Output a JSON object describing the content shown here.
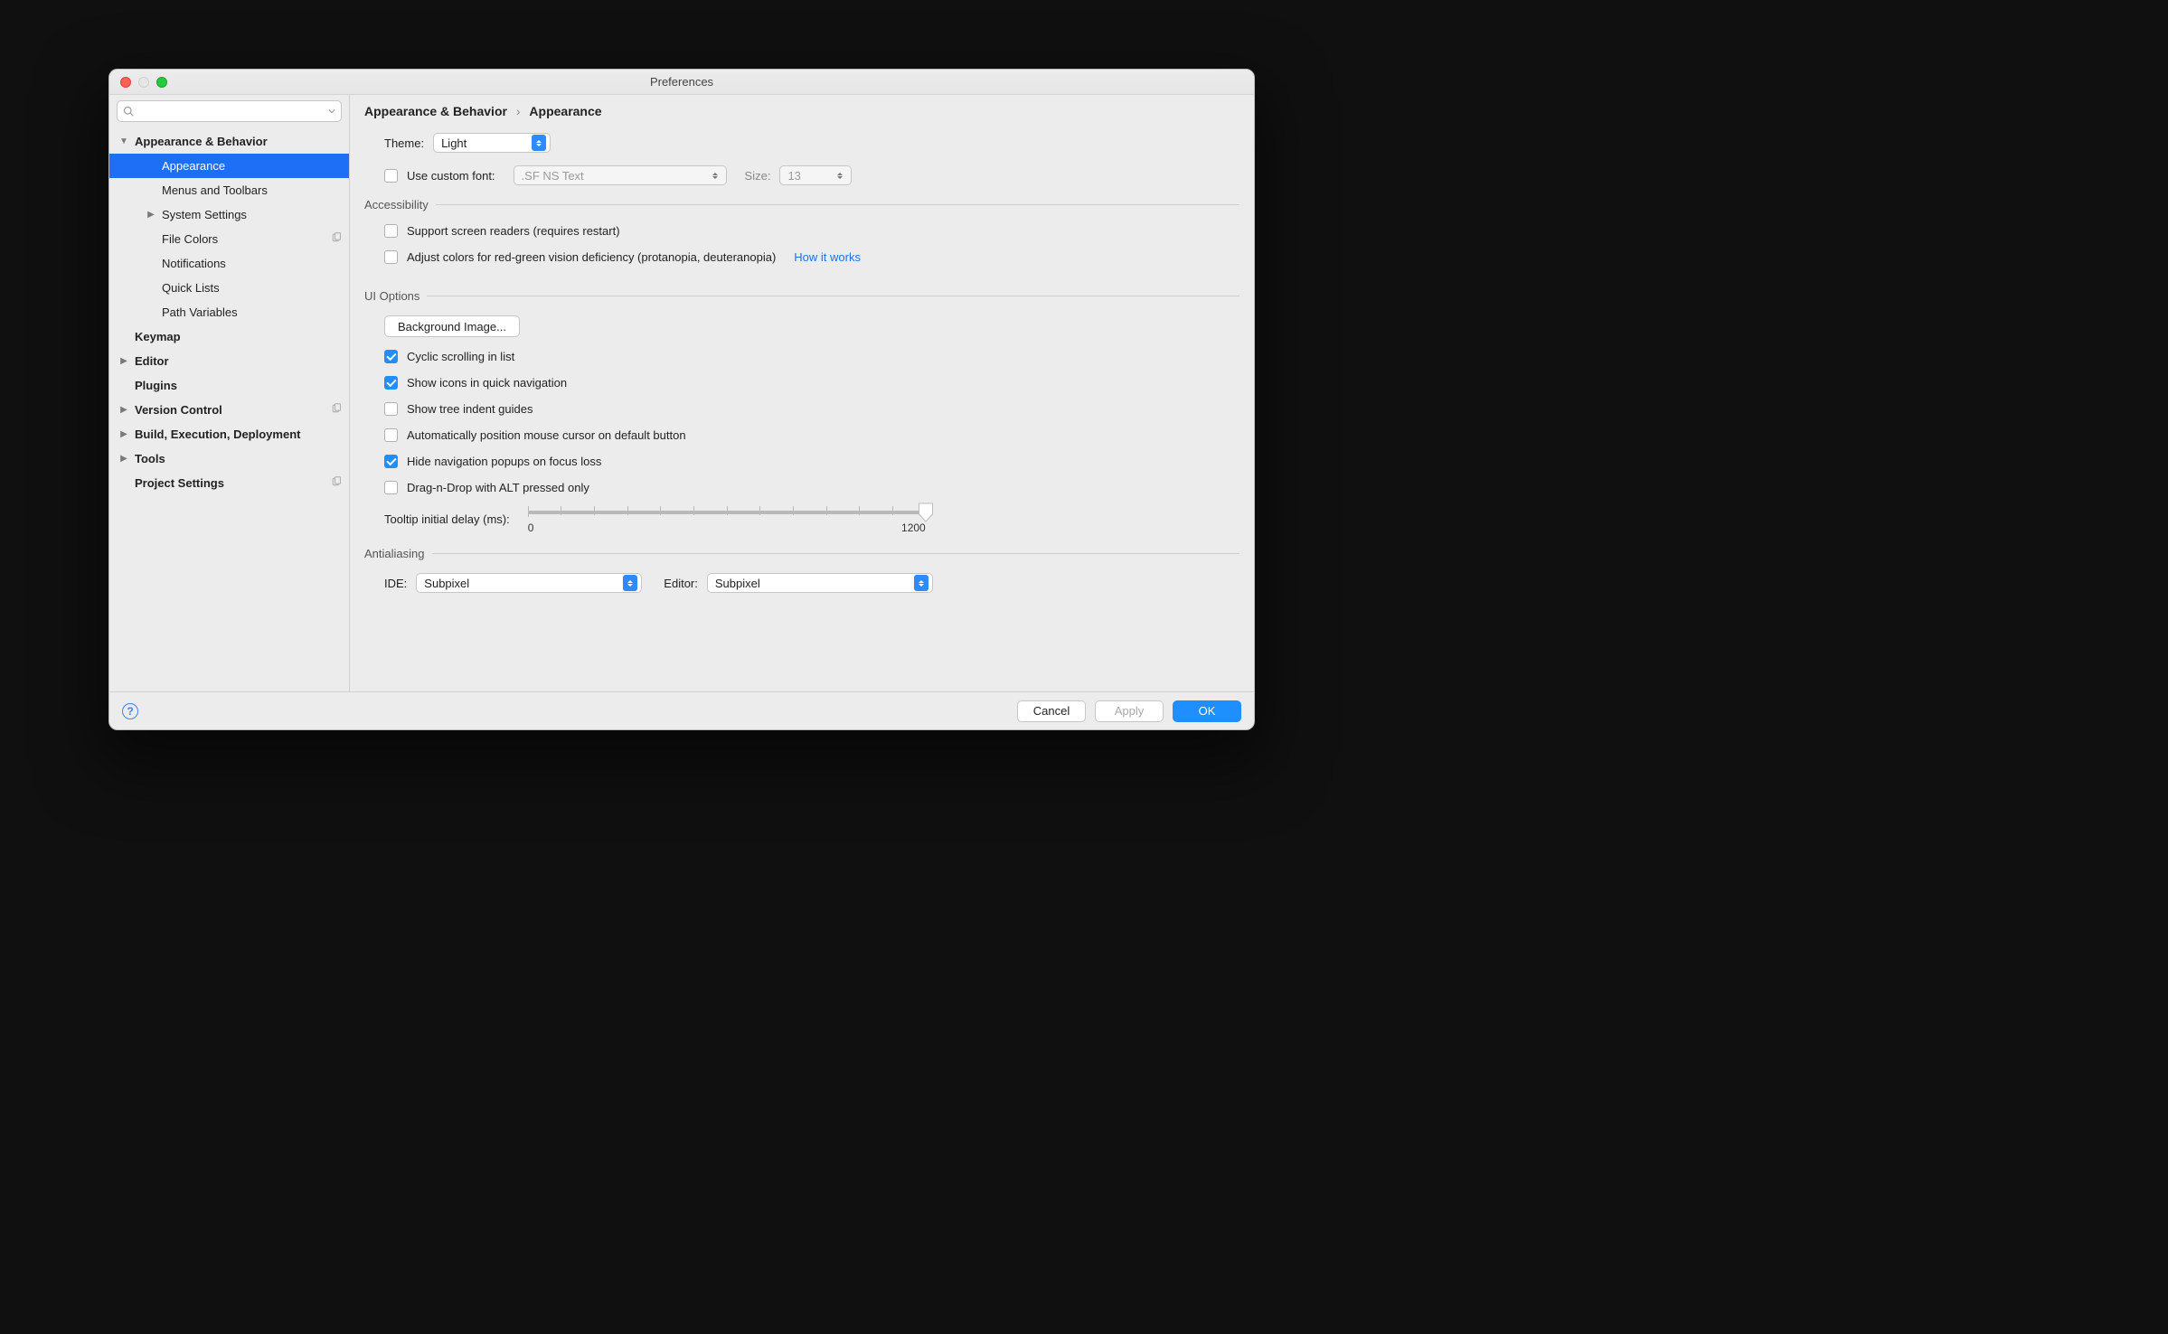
{
  "window": {
    "title": "Preferences"
  },
  "sidebar": {
    "search_placeholder": "",
    "items": [
      {
        "label": "Appearance & Behavior",
        "depth": 0,
        "bold": true,
        "arrow": "down",
        "selected": false
      },
      {
        "label": "Appearance",
        "depth": 1,
        "bold": false,
        "arrow": "",
        "selected": true
      },
      {
        "label": "Menus and Toolbars",
        "depth": 1,
        "bold": false,
        "arrow": "",
        "selected": false
      },
      {
        "label": "System Settings",
        "depth": 1,
        "bold": false,
        "arrow": "right",
        "selected": false
      },
      {
        "label": "File Colors",
        "depth": 1,
        "bold": false,
        "arrow": "",
        "selected": false,
        "badge": "copy"
      },
      {
        "label": "Notifications",
        "depth": 1,
        "bold": false,
        "arrow": "",
        "selected": false
      },
      {
        "label": "Quick Lists",
        "depth": 1,
        "bold": false,
        "arrow": "",
        "selected": false
      },
      {
        "label": "Path Variables",
        "depth": 1,
        "bold": false,
        "arrow": "",
        "selected": false
      },
      {
        "label": "Keymap",
        "depth": 0,
        "bold": true,
        "arrow": "",
        "selected": false
      },
      {
        "label": "Editor",
        "depth": 0,
        "bold": true,
        "arrow": "right",
        "selected": false
      },
      {
        "label": "Plugins",
        "depth": 0,
        "bold": true,
        "arrow": "",
        "selected": false
      },
      {
        "label": "Version Control",
        "depth": 0,
        "bold": true,
        "arrow": "right",
        "selected": false,
        "badge": "copy"
      },
      {
        "label": "Build, Execution, Deployment",
        "depth": 0,
        "bold": true,
        "arrow": "right",
        "selected": false
      },
      {
        "label": "Tools",
        "depth": 0,
        "bold": true,
        "arrow": "right",
        "selected": false
      },
      {
        "label": "Project Settings",
        "depth": 0,
        "bold": true,
        "arrow": "",
        "selected": false,
        "badge": "copy"
      }
    ]
  },
  "breadcrumb": {
    "parent": "Appearance & Behavior",
    "current": "Appearance"
  },
  "theme": {
    "label": "Theme:",
    "value": "Light"
  },
  "custom_font": {
    "checkbox_label": "Use custom font:",
    "checked": false,
    "font_value": ".SF NS Text",
    "size_label": "Size:",
    "size_value": "13"
  },
  "accessibility": {
    "legend": "Accessibility",
    "screen_readers": {
      "checked": false,
      "label": "Support screen readers (requires restart)"
    },
    "color_deficiency": {
      "checked": false,
      "label": "Adjust colors for red-green vision deficiency (protanopia, deuteranopia)"
    },
    "how_it_works": "How it works"
  },
  "ui_options": {
    "legend": "UI Options",
    "background_image": "Background Image...",
    "cyclic_scrolling": {
      "checked": true,
      "label": "Cyclic scrolling in list"
    },
    "show_icons": {
      "checked": true,
      "label": "Show icons in quick navigation"
    },
    "tree_indent": {
      "checked": false,
      "label": "Show tree indent guides"
    },
    "auto_cursor": {
      "checked": false,
      "label": "Automatically position mouse cursor on default button"
    },
    "hide_popups": {
      "checked": true,
      "label": "Hide navigation popups on focus loss"
    },
    "drag_alt": {
      "checked": false,
      "label": "Drag-n-Drop with ALT pressed only"
    },
    "tooltip_delay": {
      "label": "Tooltip initial delay (ms):",
      "min": "0",
      "max": "1200",
      "value": 1200
    }
  },
  "antialiasing": {
    "legend": "Antialiasing",
    "ide": {
      "label": "IDE:",
      "value": "Subpixel"
    },
    "editor": {
      "label": "Editor:",
      "value": "Subpixel"
    }
  },
  "footer": {
    "cancel": "Cancel",
    "apply": "Apply",
    "ok": "OK"
  }
}
